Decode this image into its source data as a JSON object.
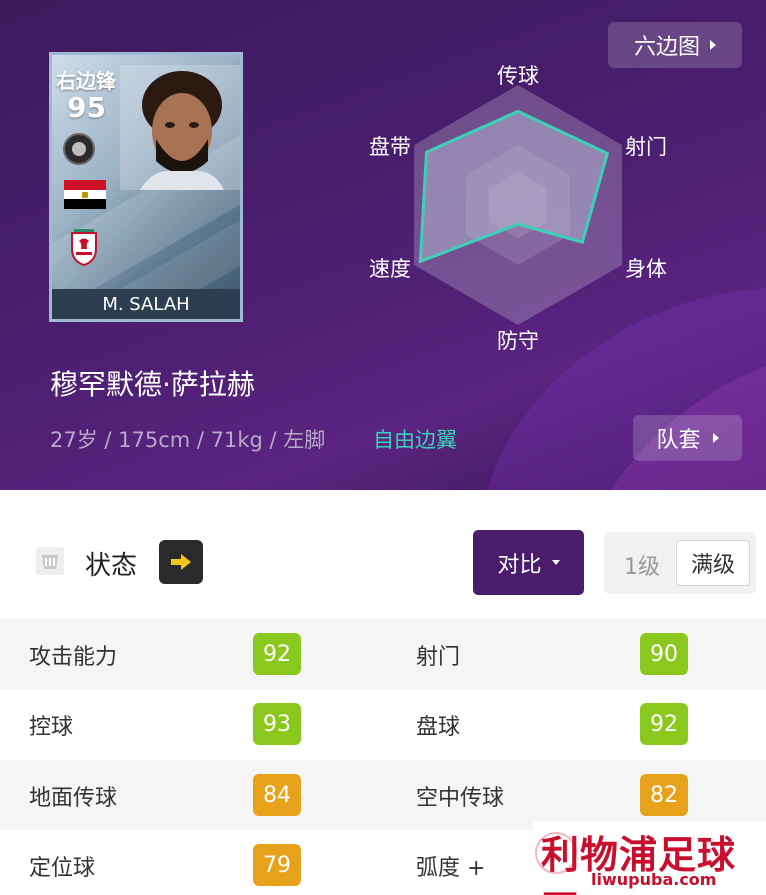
{
  "hero": {
    "hexagon_button_label": "六边图",
    "kit_button_label": "队套",
    "player_full_name": "穆罕默德·萨拉赫",
    "player_info": "27岁 / 175cm / 71kg / 左脚",
    "play_style": "自由边翼",
    "colors": {
      "background": "#4a1e6e",
      "accent_teal": "#3ad1b7"
    }
  },
  "card": {
    "position": "右边锋",
    "rating": "95",
    "name": "M. SALAH",
    "nation_flag": "egypt-flag-icon",
    "club_badge": "liverpool-crest-icon",
    "badge_icon": "league-badge-icon"
  },
  "radar": {
    "axes": [
      {
        "label": "传球",
        "value": 0.78
      },
      {
        "label": "射门",
        "value": 0.86
      },
      {
        "label": "身体",
        "value": 0.62
      },
      {
        "label": "防守",
        "value": 0.16
      },
      {
        "label": "速度",
        "value": 0.94
      },
      {
        "label": "盘带",
        "value": 0.88
      }
    ]
  },
  "controls": {
    "status_label": "状态",
    "status_icon": "status-icon",
    "status_arrow_icon": "arrow-right-icon",
    "compare_label": "对比",
    "level_1_label": "1级",
    "level_max_label": "满级"
  },
  "stats": [
    {
      "left_label": "攻击能力",
      "left_value": "92",
      "left_color": "#8bc81e",
      "right_label": "射门",
      "right_value": "90",
      "right_color": "#8bc81e"
    },
    {
      "left_label": "控球",
      "left_value": "93",
      "left_color": "#8bc81e",
      "right_label": "盘球",
      "right_value": "92",
      "right_color": "#8bc81e"
    },
    {
      "left_label": "地面传球",
      "left_value": "84",
      "left_color": "#e5a21a",
      "right_label": "空中传球",
      "right_value": "82",
      "right_color": "#e5a21a"
    },
    {
      "left_label": "定位球",
      "left_value": "79",
      "left_color": "#e5a21a",
      "right_label": "弧度 +",
      "right_value": "",
      "right_color": "#e5a21a"
    }
  ],
  "watermark": {
    "main": "利物浦足球网",
    "sub": "liwupuba.com"
  }
}
